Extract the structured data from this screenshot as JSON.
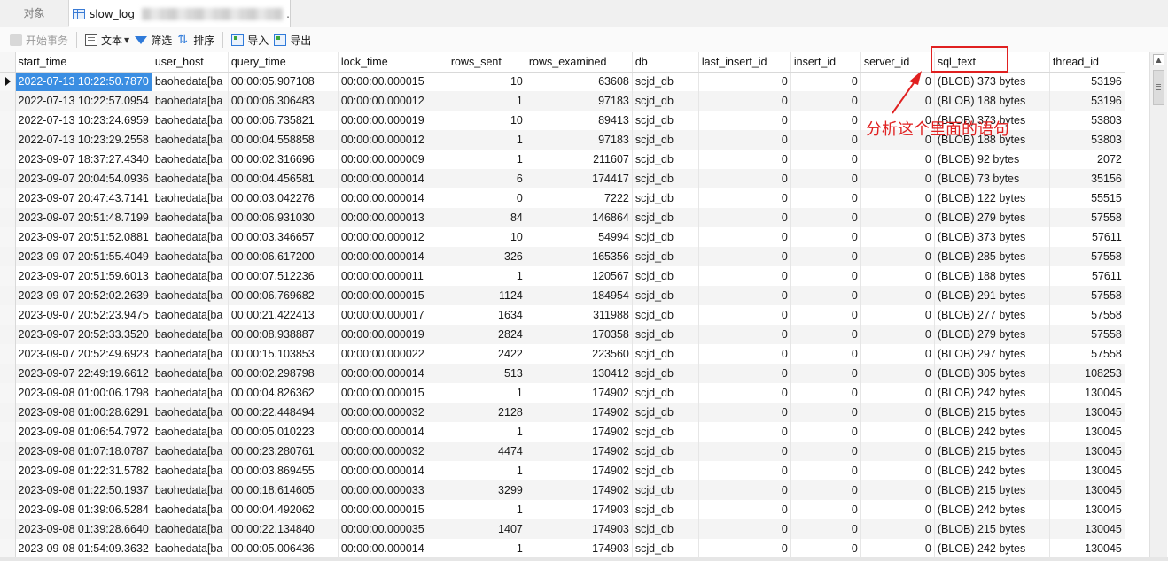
{
  "tabs": {
    "objects": "对象",
    "table": "slow_log",
    "dot": "."
  },
  "toolbar": {
    "begin_tx": "开始事务",
    "text": "文本",
    "filter": "筛选",
    "sort": "排序",
    "import": "导入",
    "export": "导出"
  },
  "columns": [
    "start_time",
    "user_host",
    "query_time",
    "lock_time",
    "rows_sent",
    "rows_examined",
    "db",
    "last_insert_id",
    "insert_id",
    "server_id",
    "sql_text",
    "thread_id"
  ],
  "rows": [
    [
      "2022-07-13 10:22:50.7870",
      "baohedata[ba",
      "00:00:05.907108",
      "00:00:00.000015",
      "10",
      "63608",
      "scjd_db",
      "0",
      "0",
      "0",
      "(BLOB) 373 bytes",
      "53196"
    ],
    [
      "2022-07-13 10:22:57.0954",
      "baohedata[ba",
      "00:00:06.306483",
      "00:00:00.000012",
      "1",
      "97183",
      "scjd_db",
      "0",
      "0",
      "0",
      "(BLOB) 188 bytes",
      "53196"
    ],
    [
      "2022-07-13 10:23:24.6959",
      "baohedata[ba",
      "00:00:06.735821",
      "00:00:00.000019",
      "10",
      "89413",
      "scjd_db",
      "0",
      "0",
      "0",
      "(BLOB) 373 bytes",
      "53803"
    ],
    [
      "2022-07-13 10:23:29.2558",
      "baohedata[ba",
      "00:00:04.558858",
      "00:00:00.000012",
      "1",
      "97183",
      "scjd_db",
      "0",
      "0",
      "0",
      "(BLOB) 188 bytes",
      "53803"
    ],
    [
      "2023-09-07 18:37:27.4340",
      "baohedata[ba",
      "00:00:02.316696",
      "00:00:00.000009",
      "1",
      "211607",
      "scjd_db",
      "0",
      "0",
      "0",
      "(BLOB) 92 bytes",
      "2072"
    ],
    [
      "2023-09-07 20:04:54.0936",
      "baohedata[ba",
      "00:00:04.456581",
      "00:00:00.000014",
      "6",
      "174417",
      "scjd_db",
      "0",
      "0",
      "0",
      "(BLOB) 73 bytes",
      "35156"
    ],
    [
      "2023-09-07 20:47:43.7141",
      "baohedata[ba",
      "00:00:03.042276",
      "00:00:00.000014",
      "0",
      "7222",
      "scjd_db",
      "0",
      "0",
      "0",
      "(BLOB) 122 bytes",
      "55515"
    ],
    [
      "2023-09-07 20:51:48.7199",
      "baohedata[ba",
      "00:00:06.931030",
      "00:00:00.000013",
      "84",
      "146864",
      "scjd_db",
      "0",
      "0",
      "0",
      "(BLOB) 279 bytes",
      "57558"
    ],
    [
      "2023-09-07 20:51:52.0881",
      "baohedata[ba",
      "00:00:03.346657",
      "00:00:00.000012",
      "10",
      "54994",
      "scjd_db",
      "0",
      "0",
      "0",
      "(BLOB) 373 bytes",
      "57611"
    ],
    [
      "2023-09-07 20:51:55.4049",
      "baohedata[ba",
      "00:00:06.617200",
      "00:00:00.000014",
      "326",
      "165356",
      "scjd_db",
      "0",
      "0",
      "0",
      "(BLOB) 285 bytes",
      "57558"
    ],
    [
      "2023-09-07 20:51:59.6013",
      "baohedata[ba",
      "00:00:07.512236",
      "00:00:00.000011",
      "1",
      "120567",
      "scjd_db",
      "0",
      "0",
      "0",
      "(BLOB) 188 bytes",
      "57611"
    ],
    [
      "2023-09-07 20:52:02.2639",
      "baohedata[ba",
      "00:00:06.769682",
      "00:00:00.000015",
      "1124",
      "184954",
      "scjd_db",
      "0",
      "0",
      "0",
      "(BLOB) 291 bytes",
      "57558"
    ],
    [
      "2023-09-07 20:52:23.9475",
      "baohedata[ba",
      "00:00:21.422413",
      "00:00:00.000017",
      "1634",
      "311988",
      "scjd_db",
      "0",
      "0",
      "0",
      "(BLOB) 277 bytes",
      "57558"
    ],
    [
      "2023-09-07 20:52:33.3520",
      "baohedata[ba",
      "00:00:08.938887",
      "00:00:00.000019",
      "2824",
      "170358",
      "scjd_db",
      "0",
      "0",
      "0",
      "(BLOB) 279 bytes",
      "57558"
    ],
    [
      "2023-09-07 20:52:49.6923",
      "baohedata[ba",
      "00:00:15.103853",
      "00:00:00.000022",
      "2422",
      "223560",
      "scjd_db",
      "0",
      "0",
      "0",
      "(BLOB) 297 bytes",
      "57558"
    ],
    [
      "2023-09-07 22:49:19.6612",
      "baohedata[ba",
      "00:00:02.298798",
      "00:00:00.000014",
      "513",
      "130412",
      "scjd_db",
      "0",
      "0",
      "0",
      "(BLOB) 305 bytes",
      "108253"
    ],
    [
      "2023-09-08 01:00:06.1798",
      "baohedata[ba",
      "00:00:04.826362",
      "00:00:00.000015",
      "1",
      "174902",
      "scjd_db",
      "0",
      "0",
      "0",
      "(BLOB) 242 bytes",
      "130045"
    ],
    [
      "2023-09-08 01:00:28.6291",
      "baohedata[ba",
      "00:00:22.448494",
      "00:00:00.000032",
      "2128",
      "174902",
      "scjd_db",
      "0",
      "0",
      "0",
      "(BLOB) 215 bytes",
      "130045"
    ],
    [
      "2023-09-08 01:06:54.7972",
      "baohedata[ba",
      "00:00:05.010223",
      "00:00:00.000014",
      "1",
      "174902",
      "scjd_db",
      "0",
      "0",
      "0",
      "(BLOB) 242 bytes",
      "130045"
    ],
    [
      "2023-09-08 01:07:18.0787",
      "baohedata[ba",
      "00:00:23.280761",
      "00:00:00.000032",
      "4474",
      "174902",
      "scjd_db",
      "0",
      "0",
      "0",
      "(BLOB) 215 bytes",
      "130045"
    ],
    [
      "2023-09-08 01:22:31.5782",
      "baohedata[ba",
      "00:00:03.869455",
      "00:00:00.000014",
      "1",
      "174902",
      "scjd_db",
      "0",
      "0",
      "0",
      "(BLOB) 242 bytes",
      "130045"
    ],
    [
      "2023-09-08 01:22:50.1937",
      "baohedata[ba",
      "00:00:18.614605",
      "00:00:00.000033",
      "3299",
      "174902",
      "scjd_db",
      "0",
      "0",
      "0",
      "(BLOB) 215 bytes",
      "130045"
    ],
    [
      "2023-09-08 01:39:06.5284",
      "baohedata[ba",
      "00:00:04.492062",
      "00:00:00.000015",
      "1",
      "174903",
      "scjd_db",
      "0",
      "0",
      "0",
      "(BLOB) 242 bytes",
      "130045"
    ],
    [
      "2023-09-08 01:39:28.6640",
      "baohedata[ba",
      "00:00:22.134840",
      "00:00:00.000035",
      "1407",
      "174903",
      "scjd_db",
      "0",
      "0",
      "0",
      "(BLOB) 215 bytes",
      "130045"
    ],
    [
      "2023-09-08 01:54:09.3632",
      "baohedata[ba",
      "00:00:05.006436",
      "00:00:00.000014",
      "1",
      "174903",
      "scjd_db",
      "0",
      "0",
      "0",
      "(BLOB) 242 bytes",
      "130045"
    ]
  ],
  "annotation": {
    "text": "分析这个里面的语句",
    "color": "#e02020"
  },
  "colors": {
    "selection": "#3b8ee2",
    "accent": "#2f7ad9"
  }
}
